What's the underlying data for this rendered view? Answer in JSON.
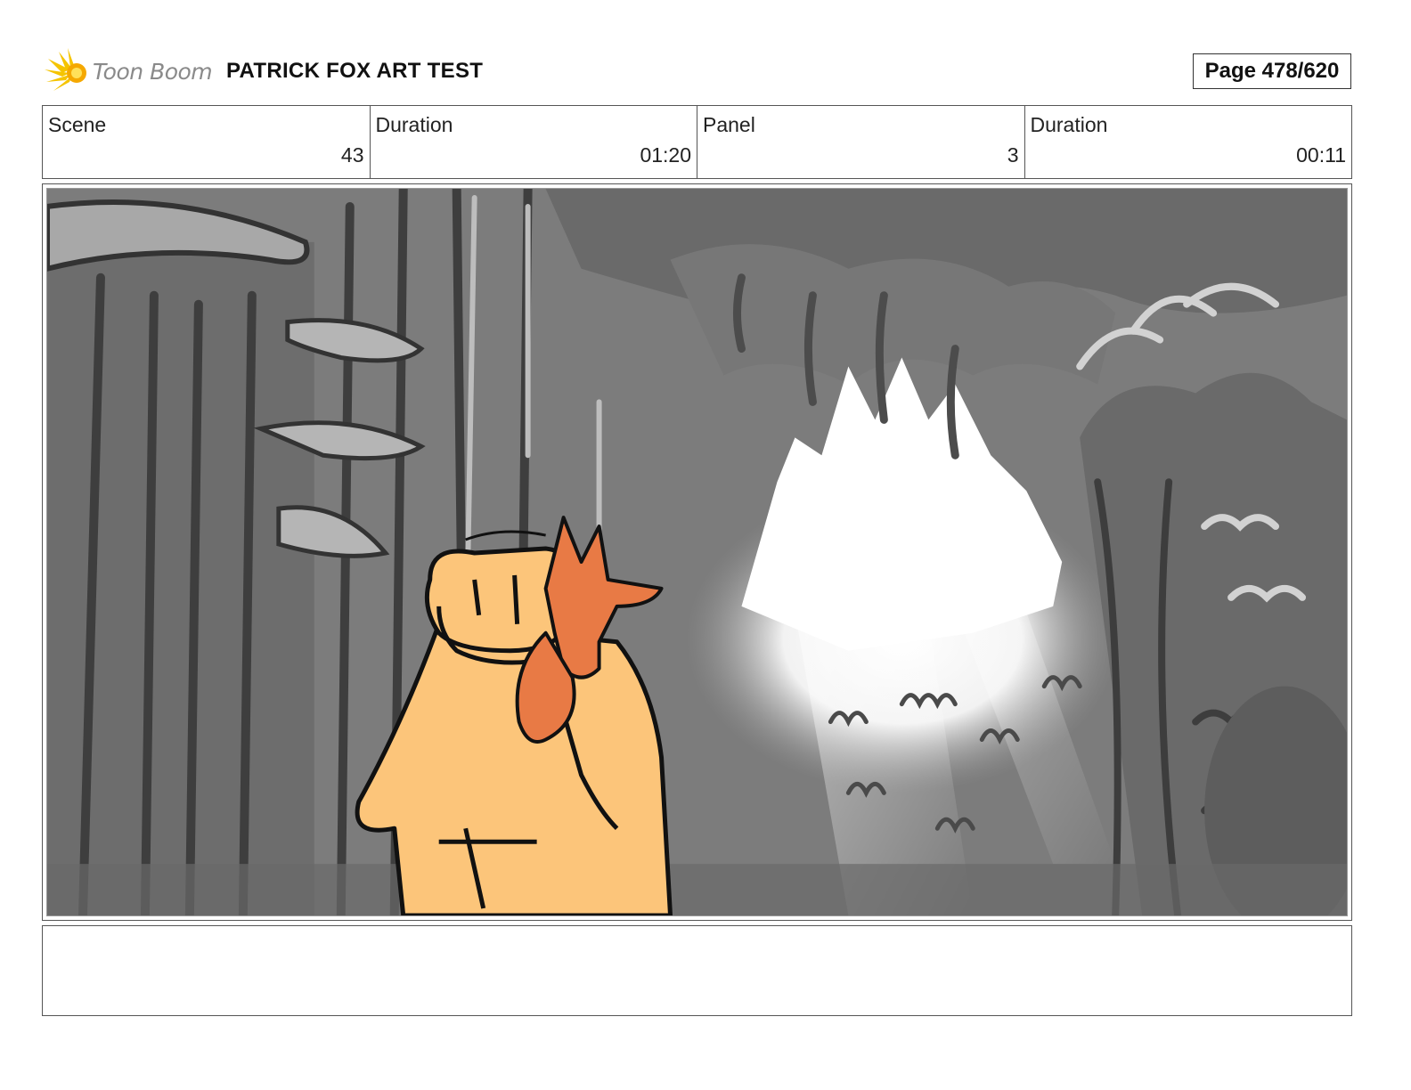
{
  "header": {
    "logo_text": "Toon Boom",
    "project_title": "PATRICK FOX ART TEST",
    "page_label": "Page 478/620"
  },
  "info": {
    "scene_label": "Scene",
    "scene_value": "43",
    "scene_duration_label": "Duration",
    "scene_duration_value": "01:20",
    "panel_label": "Panel",
    "panel_value": "3",
    "panel_duration_label": "Duration",
    "panel_duration_value": "00:11"
  },
  "notes": {
    "text": ""
  },
  "colors": {
    "logo_yellow": "#f5c400",
    "character_coat": "#fcc57a",
    "fox_orange": "#e87a45",
    "forest_gray": "#7a7a7a"
  }
}
